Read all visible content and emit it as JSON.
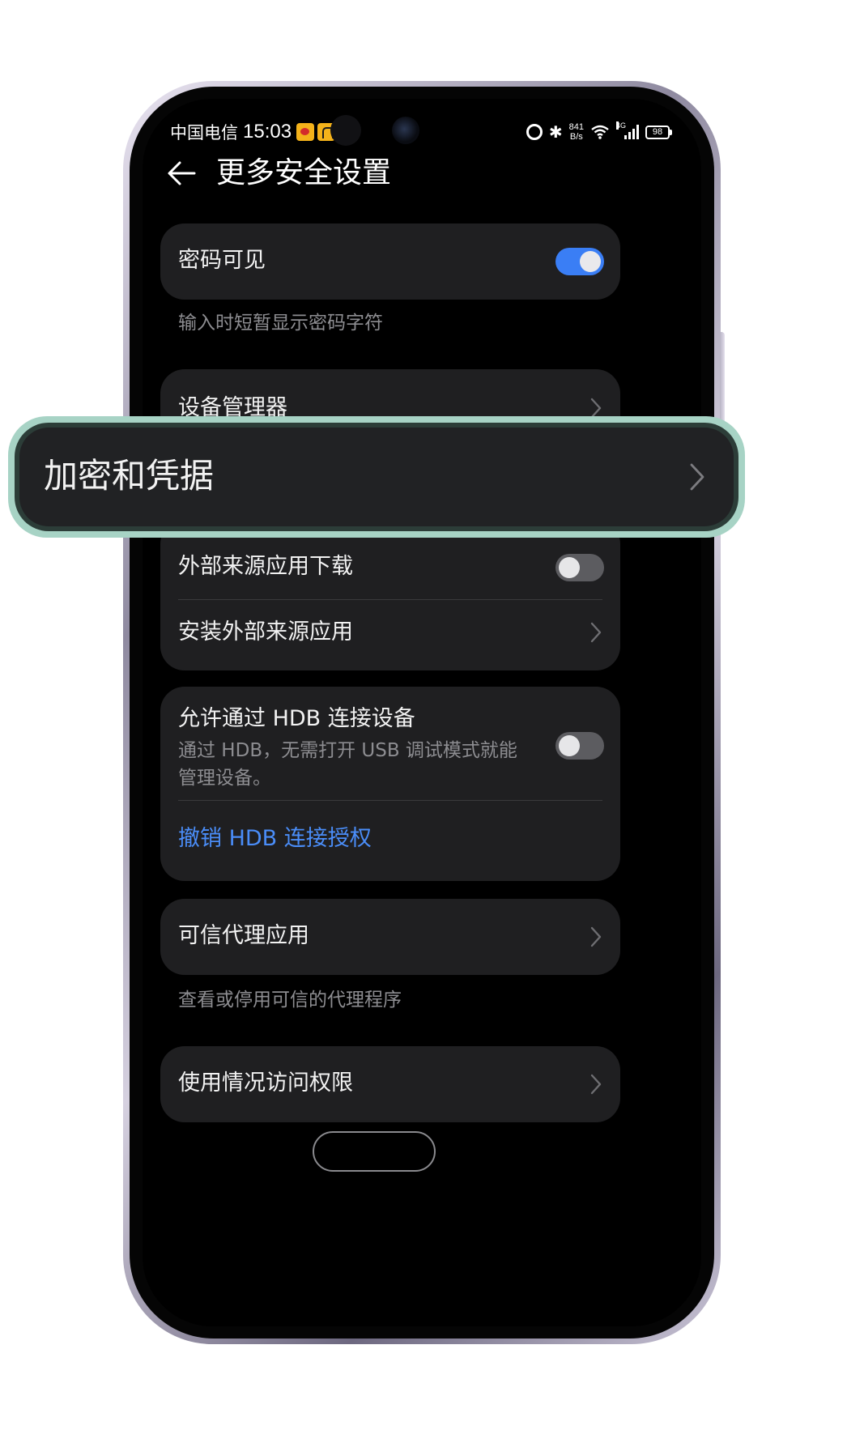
{
  "status_bar": {
    "carrier": "中国电信",
    "time": "15:03",
    "net_speed_value": "841",
    "net_speed_unit": "B/s",
    "signal_label": "4G",
    "battery": "98",
    "icons": [
      "weibo-app-icon",
      "alarm-icon",
      "bluetooth-icon",
      "wifi-icon",
      "signal-icon",
      "battery-icon"
    ]
  },
  "header": {
    "title": "更多安全设置",
    "back_icon": "arrow-left-icon"
  },
  "settings": {
    "password_visible": {
      "label": "密码可见",
      "toggle_on": true,
      "hint": "输入时短暂显示密码字符"
    },
    "device_admin": {
      "label": "设备管理器"
    },
    "encryption": {
      "label": "加密和凭据"
    },
    "external_download": {
      "label": "外部来源应用下载",
      "toggle_on": false
    },
    "install_external": {
      "label": "安装外部来源应用"
    },
    "hdb": {
      "label": "允许通过 HDB 连接设备",
      "description": "通过 HDB，无需打开 USB 调试模式就能管理设备。",
      "toggle_on": false,
      "revoke_label": "撤销 HDB 连接授权"
    },
    "trust_agents": {
      "label": "可信代理应用",
      "hint": "查看或停用可信的代理程序"
    },
    "usage_access": {
      "label": "使用情况访问权限"
    }
  },
  "callout": {
    "label": "加密和凭据"
  },
  "colors": {
    "accent_blue": "#3a7ef5",
    "link_blue": "#4a8df8",
    "card_bg": "#1f1f21",
    "callout_glow": "#a7d3c5"
  }
}
